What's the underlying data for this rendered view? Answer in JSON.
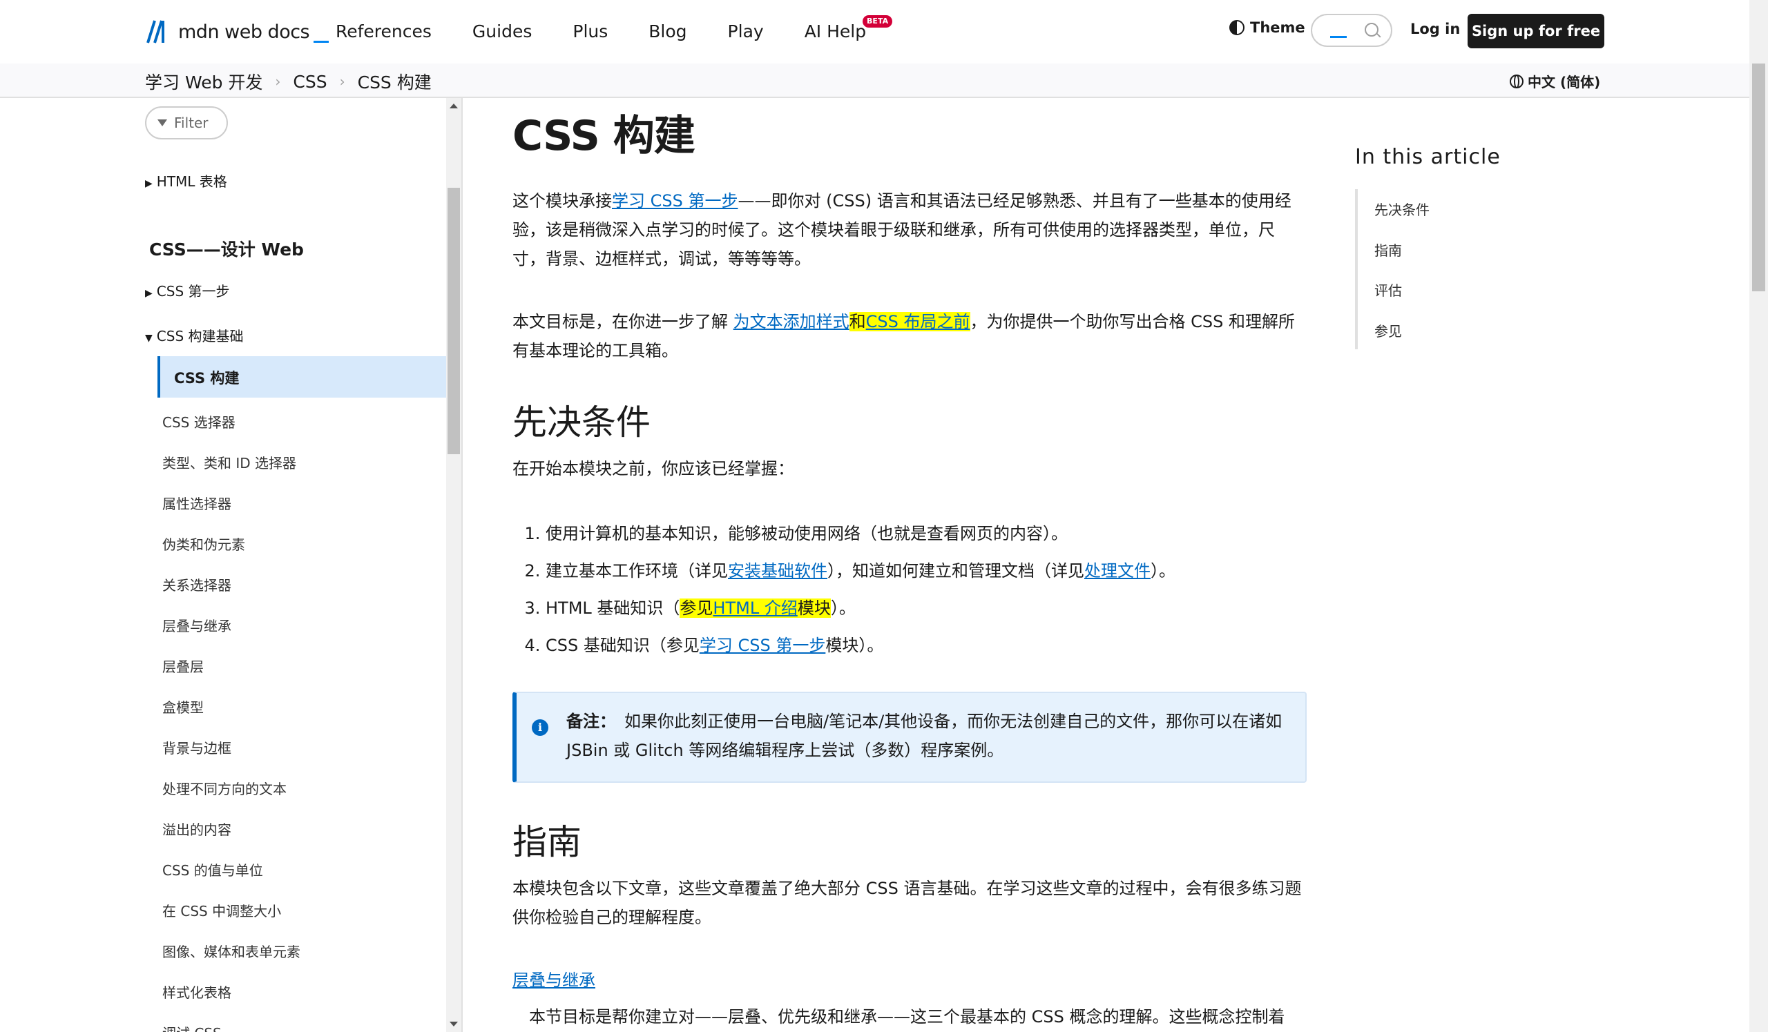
{
  "header": {
    "logo_text": "mdn web docs",
    "nav": [
      "References",
      "Guides",
      "Plus",
      "Blog",
      "Play",
      "AI Help"
    ],
    "beta_badge": "BETA",
    "theme_label": "Theme",
    "login_label": "Log in",
    "signup_label": "Sign up for free"
  },
  "breadcrumb": {
    "items": [
      "学习 Web 开发",
      "CSS",
      "CSS 构建"
    ],
    "language": "中文 (简体)"
  },
  "sidebar": {
    "filter_label": "Filter",
    "html_tables": "HTML 表格",
    "section_title": "CSS——设计 Web",
    "first_steps": "CSS 第一步",
    "building_blocks": "CSS 构建基础",
    "active_item": "CSS 构建",
    "items": [
      "CSS 选择器",
      "类型、类和 ID 选择器",
      "属性选择器",
      "伪类和伪元素",
      "关系选择器",
      "层叠与继承",
      "层叠层",
      "盒模型",
      "背景与边框",
      "处理不同方向的文本",
      "溢出的内容",
      "CSS 的值与单位",
      "在 CSS 中调整大小",
      "图像、媒体和表单元素",
      "样式化表格",
      "调试 CSS"
    ]
  },
  "main": {
    "title": "CSS 构建",
    "intro": {
      "pre": "这个模块承接",
      "link": "学习 CSS 第一步",
      "post": "——即你对 (CSS) 语言和其语法已经足够熟悉、并且有了一些基本的使用经验，该是稍微深入点学习的时候了。这个模块着眼于级联和继承，所有可供使用的选择器类型，单位，尺寸，背景、边框样式，调试，等等等等。"
    },
    "goal": {
      "pre": "本文目标是，在你进一步了解 ",
      "link1": "为文本添加样式",
      "mid": "和",
      "link2": "CSS 布局之前",
      "post": "，为你提供一个助你写出合格 CSS 和理解所有基本理论的工具箱。"
    },
    "prereq_heading": "先决条件",
    "prereq_intro": "在开始本模块之前，你应该已经掌握：",
    "prereqs": [
      {
        "pre": "使用计算机的基本知识，能够被动使用网络（也就是查看网页的内容）。"
      },
      {
        "pre": "建立基本工作环境（详见",
        "link": "安装基础软件",
        "mid": "），知道如何建立和管理文档（详见",
        "link2": "处理文件",
        "post": "）。"
      },
      {
        "pre": "HTML 基础知识（",
        "hl_pre": "参见",
        "link": "HTML 介绍",
        "hl_post": "模块",
        "post": "）。"
      },
      {
        "pre": "CSS 基础知识（参见",
        "link": "学习 CSS 第一步",
        "post": "模块）。"
      }
    ],
    "note": {
      "label": "备注：",
      "text": "如果你此刻正使用一台电脑/笔记本/其他设备，而你无法创建自己的文件，那你可以在诸如 JSBin 或 Glitch 等网络编辑程序上尝试（多数）程序案例。"
    },
    "guide_heading": "指南",
    "guide_intro": "本模块包含以下文章，这些文章覆盖了绝大部分 CSS 语言基础。在学习这些文章的过程中，会有很多练习题供你检验自己的理解程度。",
    "guide_link": "层叠与继承",
    "guide_desc": "本节目标是帮你建立对——层叠、优先级和继承——这三个最基本的 CSS 概念的理解。这些概念控制着"
  },
  "toc": {
    "title": "In this article",
    "entries": [
      "先决条件",
      "指南",
      "评估",
      "参见"
    ]
  },
  "colors": {
    "link": "#0069c2",
    "highlight": "#ffff00",
    "active_bg": "#d7e9fb",
    "note_bg": "#e6f2fd"
  }
}
